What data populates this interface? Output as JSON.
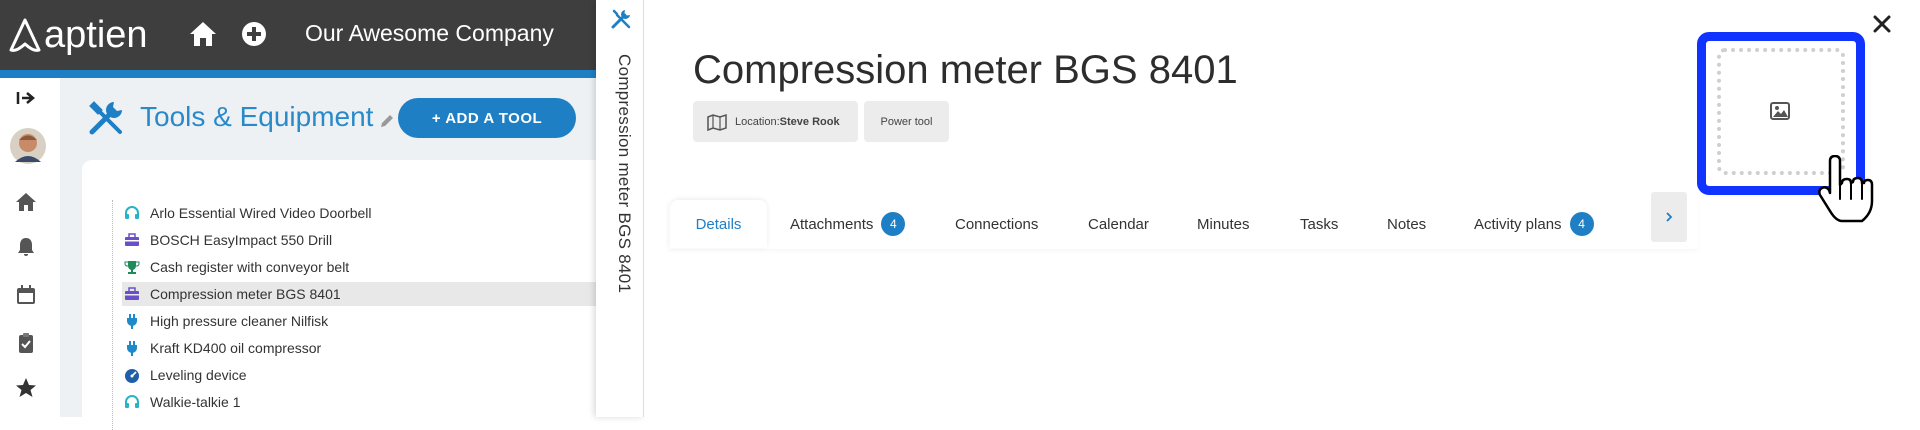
{
  "app": {
    "logo_text": "aptien",
    "company": "Our Awesome Company"
  },
  "sidebar": {
    "items": [
      {
        "icon": "collapse-arrow-icon"
      },
      {
        "icon": "avatar"
      },
      {
        "icon": "home-icon"
      },
      {
        "icon": "bell-icon"
      },
      {
        "icon": "calendar-icon"
      },
      {
        "icon": "clipboard-check-icon"
      },
      {
        "icon": "star-icon"
      }
    ]
  },
  "main": {
    "title": "Tools & Equipment",
    "add_button": "+ ADD A TOOL",
    "list": [
      {
        "label": "Arlo Essential Wired Video Doorbell",
        "icon": "headset-icon",
        "color": "#25b5c7"
      },
      {
        "label": "BOSCH EasyImpact 550 Drill",
        "icon": "toolbox-icon",
        "color": "#6a4fc9"
      },
      {
        "label": "Cash register with conveyor belt",
        "icon": "trophy-icon",
        "color": "#1f8a5a"
      },
      {
        "label": "Compression meter BGS 8401",
        "icon": "toolbox-icon",
        "color": "#6a4fc9",
        "selected": true
      },
      {
        "label": "High pressure cleaner Nilfisk",
        "icon": "plug-icon",
        "color": "#1f8ac9"
      },
      {
        "label": "Kraft KD400 oil compressor",
        "icon": "plug-icon",
        "color": "#1f8ac9"
      },
      {
        "label": "Leveling device",
        "icon": "gauge-icon",
        "color": "#1f5fa8"
      },
      {
        "label": "Walkie-talkie 1",
        "icon": "headset-icon",
        "color": "#25b5c7"
      }
    ]
  },
  "detail": {
    "vertical_title": "Compression meter BGS 8401",
    "title": "Compression meter BGS 8401",
    "location_label": "Location:",
    "location_value": "Steve Rook",
    "type_chip": "Power tool",
    "tabs": [
      {
        "label": "Details",
        "active": true
      },
      {
        "label": "Attachments",
        "badge": "4"
      },
      {
        "label": "Connections"
      },
      {
        "label": "Calendar"
      },
      {
        "label": "Minutes"
      },
      {
        "label": "Tasks"
      },
      {
        "label": "Notes"
      },
      {
        "label": "Activity plans",
        "badge": "4"
      }
    ],
    "accent_color": "#1f7fc4",
    "highlight_color": "#1033ff"
  }
}
